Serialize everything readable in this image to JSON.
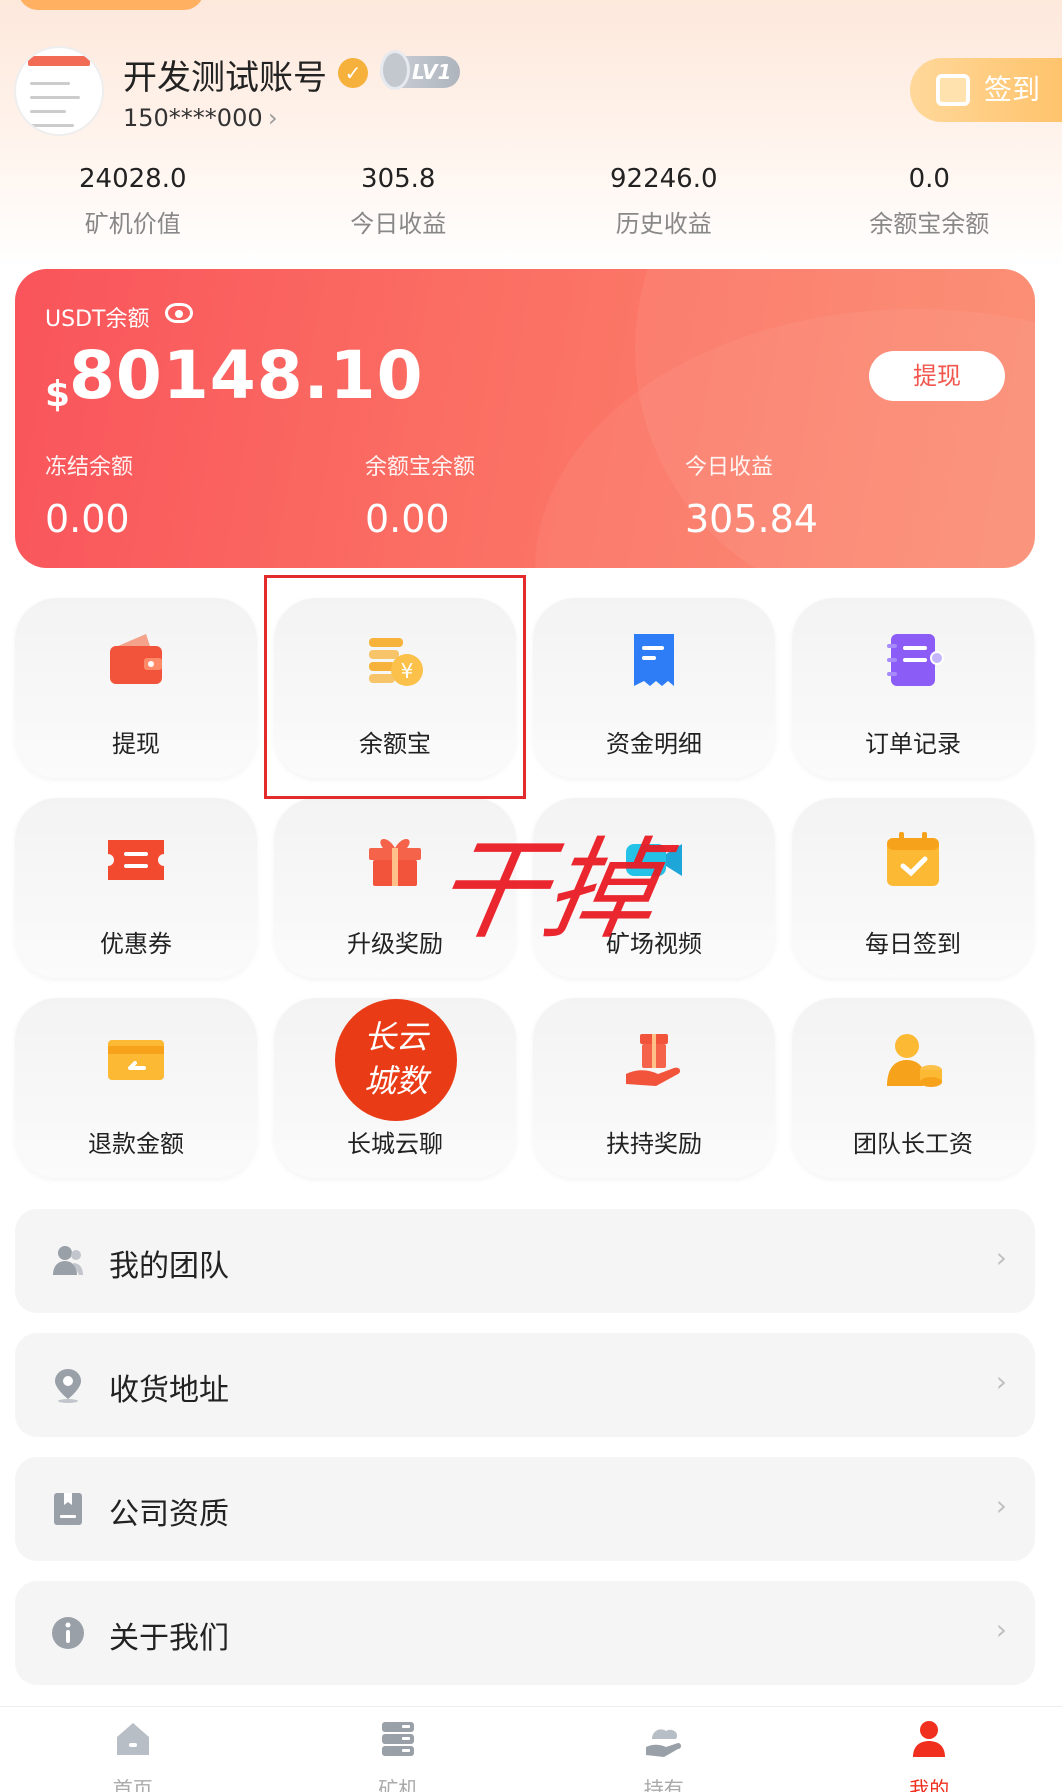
{
  "profile": {
    "name": "开发测试账号",
    "level": "LV1",
    "phone": "150****000",
    "checkin_label": "签到"
  },
  "stats": [
    {
      "value": "24028.0",
      "label": "矿机价值"
    },
    {
      "value": "305.8",
      "label": "今日收益"
    },
    {
      "value": "92246.0",
      "label": "历史收益"
    },
    {
      "value": "0.0",
      "label": "余额宝余额"
    }
  ],
  "balance": {
    "label": "USDT余额",
    "currency": "$",
    "amount": "80148.10",
    "withdraw_label": "提现",
    "sub": [
      {
        "label": "冻结余额",
        "value": "0.00"
      },
      {
        "label": "余额宝余额",
        "value": "0.00"
      },
      {
        "label": "今日收益",
        "value": "305.84"
      }
    ]
  },
  "grid": [
    {
      "label": "提现",
      "icon": "wallet-icon"
    },
    {
      "label": "余额宝",
      "icon": "coins-icon"
    },
    {
      "label": "资金明细",
      "icon": "receipt-icon"
    },
    {
      "label": "订单记录",
      "icon": "order-list-icon"
    },
    {
      "label": "优惠券",
      "icon": "coupon-icon"
    },
    {
      "label": "升级奖励",
      "icon": "gift-icon"
    },
    {
      "label": "矿场视频",
      "icon": "video-icon"
    },
    {
      "label": "每日签到",
      "icon": "calendar-check-icon"
    },
    {
      "label": "退款金额",
      "icon": "refund-card-icon"
    },
    {
      "label": "长城云聊",
      "icon": "chat-seal-icon"
    },
    {
      "label": "扶持奖励",
      "icon": "support-gift-icon"
    },
    {
      "label": "团队长工资",
      "icon": "leader-salary-icon"
    }
  ],
  "annotation": {
    "overlay_text": "干掉",
    "seal_text_top": "长云",
    "seal_text_bottom": "城数"
  },
  "menu": [
    {
      "label": "我的团队",
      "icon": "team-icon"
    },
    {
      "label": "收货地址",
      "icon": "location-icon"
    },
    {
      "label": "公司资质",
      "icon": "certificate-icon"
    },
    {
      "label": "关于我们",
      "icon": "info-icon"
    }
  ],
  "tabs": [
    {
      "label": "首页",
      "icon": "home-icon"
    },
    {
      "label": "矿机",
      "icon": "server-icon"
    },
    {
      "label": "持有",
      "icon": "holding-icon"
    },
    {
      "label": "我的",
      "icon": "user-icon",
      "active": true
    }
  ],
  "colors": {
    "accent": "#f2554d",
    "active_tab": "#f02f1f",
    "annotation_red": "#e32b2b"
  }
}
